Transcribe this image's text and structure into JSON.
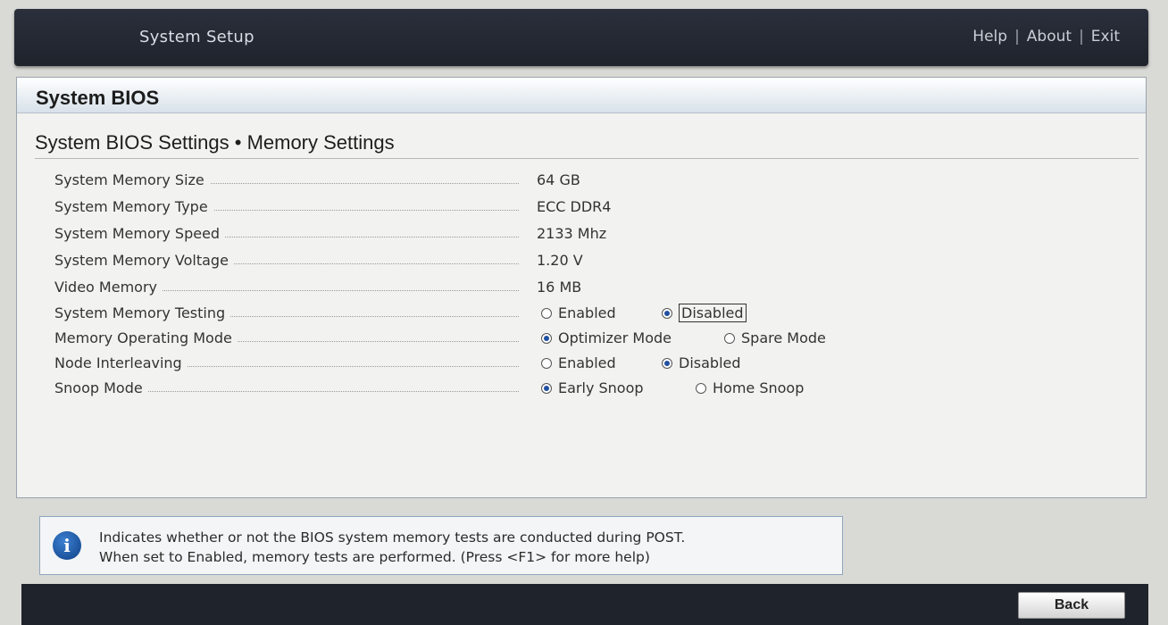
{
  "header": {
    "title": "System Setup",
    "links": {
      "help": "Help",
      "about": "About",
      "exit": "Exit",
      "separator": "|"
    }
  },
  "panel": {
    "title": "System BIOS",
    "breadcrumb": "System BIOS Settings • Memory Settings"
  },
  "settings": {
    "memory_size": {
      "label": "System Memory Size",
      "value": "64 GB"
    },
    "memory_type": {
      "label": "System Memory Type",
      "value": "ECC DDR4"
    },
    "memory_speed": {
      "label": "System Memory Speed",
      "value": "2133 Mhz"
    },
    "memory_voltage": {
      "label": "System Memory Voltage",
      "value": "1.20 V"
    },
    "video_memory": {
      "label": "Video Memory",
      "value": "16 MB"
    },
    "memory_testing": {
      "label": "System Memory Testing",
      "options": [
        "Enabled",
        "Disabled"
      ],
      "selected": "Disabled"
    },
    "operating_mode": {
      "label": "Memory Operating Mode",
      "options": [
        "Optimizer Mode",
        "Spare Mode"
      ],
      "selected": "Optimizer Mode"
    },
    "node_interleaving": {
      "label": "Node Interleaving",
      "options": [
        "Enabled",
        "Disabled"
      ],
      "selected": "Disabled"
    },
    "snoop_mode": {
      "label": "Snoop Mode",
      "options": [
        "Early Snoop",
        "Home Snoop"
      ],
      "selected": "Early Snoop"
    }
  },
  "help": {
    "icon": "info-icon",
    "line1": "Indicates whether or not the BIOS system memory tests are conducted during POST.",
    "line2": "When set to Enabled, memory tests are performed. (Press <F1> for more help)"
  },
  "footer": {
    "back_label": "Back"
  },
  "colors": {
    "topbar": "#1f232c",
    "radio_selected": "#1f4fa0",
    "info_icon": "#0f3f86"
  }
}
